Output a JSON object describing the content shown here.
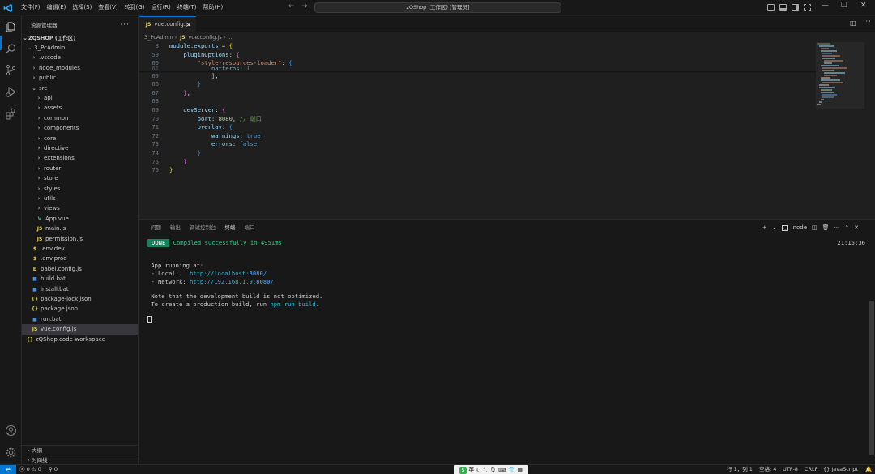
{
  "titlebar": {
    "menus": [
      "文件(F)",
      "编辑(E)",
      "选择(S)",
      "查看(V)",
      "转到(G)",
      "运行(R)",
      "终端(T)",
      "帮助(H)"
    ],
    "command_center": "zQShop (工作区) [管理员]"
  },
  "sidebar": {
    "header": "资源管理器",
    "workspace": "ZQSHOP (工作区)",
    "items": [
      {
        "label": "3_PcAdmin",
        "depth": 0,
        "type": "folder-open"
      },
      {
        "label": ".vscode",
        "depth": 1,
        "type": "folder"
      },
      {
        "label": "node_modules",
        "depth": 1,
        "type": "folder"
      },
      {
        "label": "public",
        "depth": 1,
        "type": "folder"
      },
      {
        "label": "src",
        "depth": 1,
        "type": "folder-open"
      },
      {
        "label": "api",
        "depth": 2,
        "type": "folder"
      },
      {
        "label": "assets",
        "depth": 2,
        "type": "folder"
      },
      {
        "label": "common",
        "depth": 2,
        "type": "folder"
      },
      {
        "label": "components",
        "depth": 2,
        "type": "folder"
      },
      {
        "label": "core",
        "depth": 2,
        "type": "folder"
      },
      {
        "label": "directive",
        "depth": 2,
        "type": "folder"
      },
      {
        "label": "extensions",
        "depth": 2,
        "type": "folder"
      },
      {
        "label": "router",
        "depth": 2,
        "type": "folder"
      },
      {
        "label": "store",
        "depth": 2,
        "type": "folder"
      },
      {
        "label": "styles",
        "depth": 2,
        "type": "folder"
      },
      {
        "label": "utils",
        "depth": 2,
        "type": "folder"
      },
      {
        "label": "views",
        "depth": 2,
        "type": "folder"
      },
      {
        "label": "App.vue",
        "depth": 2,
        "type": "vue"
      },
      {
        "label": "main.js",
        "depth": 2,
        "type": "js"
      },
      {
        "label": "permission.js",
        "depth": 2,
        "type": "js"
      },
      {
        "label": ".env.dev",
        "depth": 1,
        "type": "env"
      },
      {
        "label": ".env.prod",
        "depth": 1,
        "type": "env"
      },
      {
        "label": "babel.config.js",
        "depth": 1,
        "type": "babel"
      },
      {
        "label": "build.bat",
        "depth": 1,
        "type": "bat"
      },
      {
        "label": "install.bat",
        "depth": 1,
        "type": "bat"
      },
      {
        "label": "package-lock.json",
        "depth": 1,
        "type": "json"
      },
      {
        "label": "package.json",
        "depth": 1,
        "type": "json"
      },
      {
        "label": "run.bat",
        "depth": 1,
        "type": "bat"
      },
      {
        "label": "vue.config.js",
        "depth": 1,
        "type": "js",
        "selected": true
      },
      {
        "label": "zQShop.code-workspace",
        "depth": 0,
        "type": "json"
      }
    ],
    "outline": "大纲",
    "timeline": "时间线"
  },
  "editor": {
    "tab": "vue.config.js",
    "breadcrumb": [
      "3_PcAdmin",
      "vue.config.js",
      "..."
    ]
  },
  "panel": {
    "tabs": [
      "问题",
      "输出",
      "调试控制台",
      "终端",
      "端口"
    ],
    "active_tab": "终端",
    "terminal_name": "node",
    "done_badge": "DONE",
    "compiled_msg": "Compiled successfully in 4951ms",
    "timestamp": "21:15:36",
    "app_running": "App running at:",
    "local_label": "- Local:   ",
    "local_url": "http://localhost:",
    "local_port": "8080",
    "local_tail": "/",
    "network_label": "- Network: ",
    "network_url": "http://192.168.1.9:",
    "network_port": "8080",
    "network_tail": "/",
    "note_line1": "Note that the development build is not optimized.",
    "note_line2a": "To create a production build, run ",
    "note_cmd": "npm run build",
    "note_line2b": "."
  },
  "statusbar": {
    "errors": "0",
    "warnings": "0",
    "ports": "0",
    "ime_text": "英",
    "position": "行 1，列 1",
    "spaces": "空格: 4",
    "encoding": "UTF-8",
    "eol": "CRLF",
    "language": "JavaScript"
  },
  "colors": {
    "accent": "#0078d4",
    "done_badge": "#16825d",
    "terminal_green": "#23d18b"
  }
}
